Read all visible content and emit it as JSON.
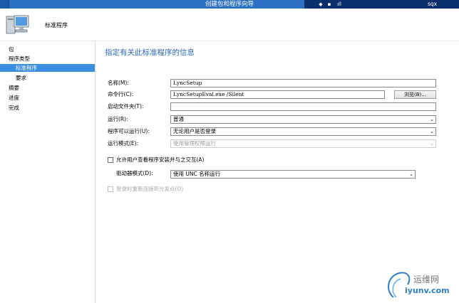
{
  "window": {
    "title": "创建包和程序向导",
    "user": "sqx"
  },
  "header": {
    "title": "标准程序",
    "icon": "computer-icon"
  },
  "sidebar": {
    "items": [
      {
        "label": "包"
      },
      {
        "label": "程序类型"
      },
      {
        "label": "标准程序",
        "active": true
      },
      {
        "label": "要求"
      },
      {
        "label": "摘要"
      },
      {
        "label": "进度"
      },
      {
        "label": "完成"
      }
    ]
  },
  "main": {
    "title": "指定有关此标准程序的信息",
    "name": {
      "label": "名称(M):",
      "value": "LyncSetup"
    },
    "command": {
      "label": "命令行(C):",
      "value": "LyncSetupEval.exe /Silent",
      "browse_label": "浏览(B)..."
    },
    "startup": {
      "label": "启动文件夹(T):",
      "value": ""
    },
    "run": {
      "label": "运行(R):",
      "value": "普通"
    },
    "can_run": {
      "label": "程序可以运行(U):",
      "value": "无论用户是否登录"
    },
    "run_mode": {
      "label": "运行模式(E):",
      "value": "使用管理权限运行",
      "disabled": true
    },
    "allow_interact": {
      "label": "允许用户查看程序安装并与之交互(A)",
      "checked": false
    },
    "drive_mode": {
      "label": "驱动器模式(D):",
      "value": "使用 UNC 名称运行"
    },
    "reconnect": {
      "label": "登录时重新连接到分发点(O)",
      "checked": false,
      "disabled": true
    }
  },
  "watermark": {
    "cn": "运维网",
    "url": "iyunv.com"
  },
  "colors": {
    "accent": "#2b70c3",
    "nav_active": "#3a8fe0",
    "title_text": "#2967b5"
  }
}
